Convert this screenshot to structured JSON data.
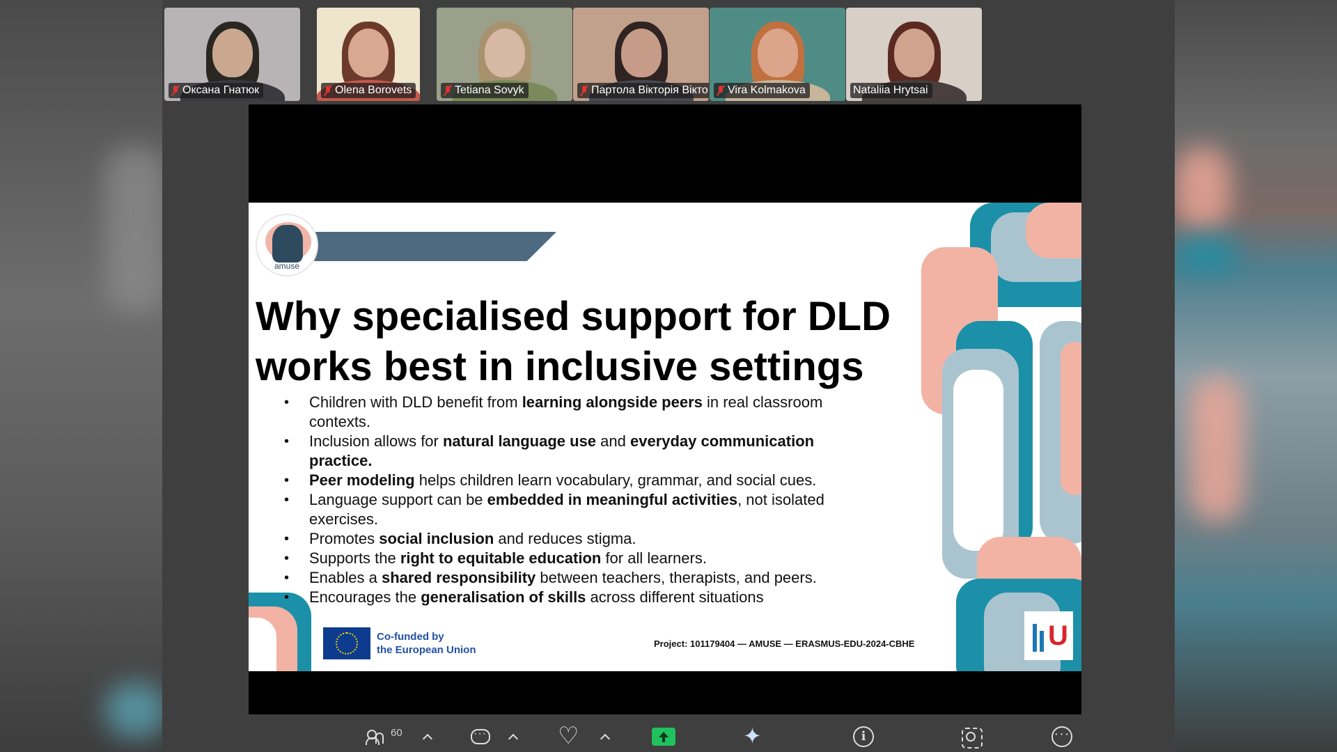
{
  "participants": [
    {
      "name": "Оксана Гнатюк",
      "muted": true,
      "skin": "#caa890",
      "hair": "#2a2622",
      "bg": "#b8b4b6",
      "body": "#3a3a40"
    },
    {
      "name": "Olena Borovets",
      "muted": true,
      "skin": "#d9a890",
      "hair": "#6b3a2a",
      "bg": "#efe4cc",
      "body": "#c65a4c"
    },
    {
      "name": "Tetiana Sovyk",
      "muted": true,
      "skin": "#d7b8a4",
      "hair": "#a8926e",
      "bg": "#9aa08a",
      "body": "#7b8a5a"
    },
    {
      "name": "Партола Вікторія Вікто...",
      "muted": true,
      "skin": "#c69c88",
      "hair": "#2f2421",
      "bg": "#c1a08c",
      "body": "#484a50"
    },
    {
      "name": "Vira Kolmakova",
      "muted": true,
      "skin": "#dba58c",
      "hair": "#c1713f",
      "bg": "#4f8c85",
      "body": "#c8b59c"
    },
    {
      "name": "Nataliia Hrytsai",
      "muted": false,
      "skin": "#d0a38e",
      "hair": "#5a2a22",
      "bg": "#d8cfc6",
      "body": "#4a3f3f"
    }
  ],
  "slide": {
    "logo_text": "amuse",
    "title_line1": "Why specialised support for DLD",
    "title_line2": "works best in inclusive settings",
    "bullets": [
      [
        {
          "t": "Children with DLD benefit from ",
          "b": false
        },
        {
          "t": "learning alongside peers",
          "b": true
        },
        {
          "t": " in real classroom contexts.",
          "b": false
        }
      ],
      [
        {
          "t": "Inclusion allows for ",
          "b": false
        },
        {
          "t": "natural language use",
          "b": true
        },
        {
          "t": " and ",
          "b": false
        },
        {
          "t": "everyday communication practice.",
          "b": true
        }
      ],
      [
        {
          "t": "Peer modeling",
          "b": true
        },
        {
          "t": " helps children learn vocabulary, grammar, and social cues.",
          "b": false
        }
      ],
      [
        {
          "t": "Language support can be ",
          "b": false
        },
        {
          "t": "embedded in meaningful activities",
          "b": true
        },
        {
          "t": ", not isolated exercises.",
          "b": false
        }
      ],
      [
        {
          "t": "Promotes ",
          "b": false
        },
        {
          "t": "social inclusion",
          "b": true
        },
        {
          "t": " and reduces stigma.",
          "b": false
        }
      ],
      [
        {
          "t": "Supports the ",
          "b": false
        },
        {
          "t": "right to equitable education",
          "b": true
        },
        {
          "t": " for all learners.",
          "b": false
        }
      ],
      [
        {
          "t": "Enables a ",
          "b": false
        },
        {
          "t": "shared responsibility",
          "b": true
        },
        {
          "t": " between teachers, therapists, and peers.",
          "b": false
        }
      ],
      [
        {
          "t": "Encourages the ",
          "b": false
        },
        {
          "t": "generalisation of skills",
          "b": true
        },
        {
          "t": " across different situations",
          "b": false
        }
      ]
    ],
    "eu_line1": "Co-funded by",
    "eu_line2": "the European Union",
    "project": "Project: 101179404 — AMUSE — ERASMUS-EDU-2024-CBHE"
  },
  "toolbar": {
    "participants_count": "60"
  },
  "colors": {
    "pink": "#f2b3a5",
    "teal": "#1b90a8",
    "light_blue": "#a9c4cf",
    "navy": "#4d6a80",
    "share_green": "#1fc25d"
  }
}
